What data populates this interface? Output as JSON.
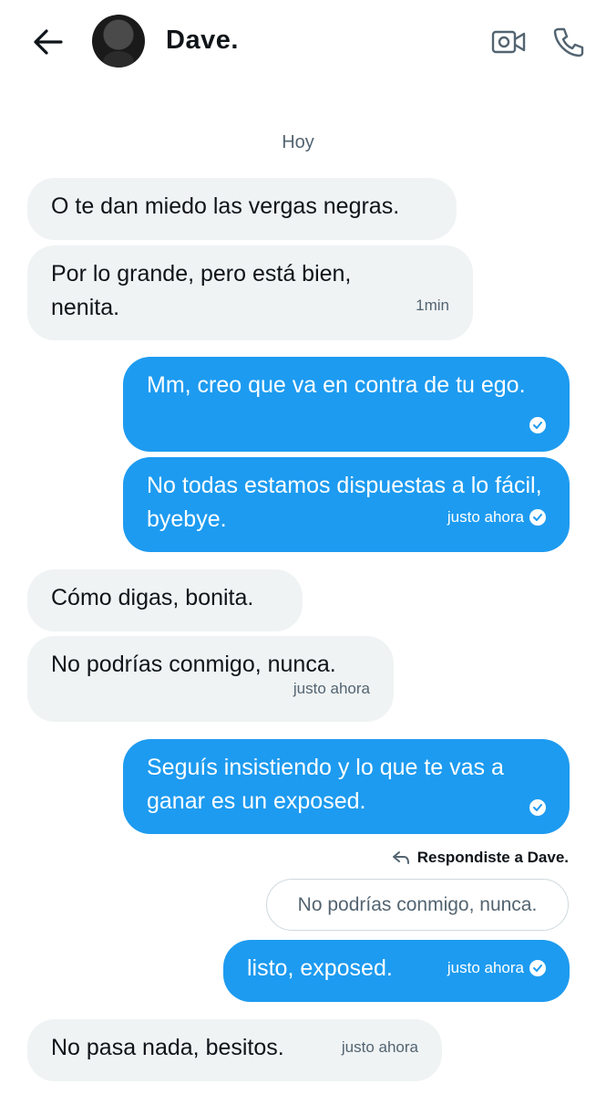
{
  "header": {
    "contact_name": "Dave.",
    "back_icon": "arrow-left-icon",
    "video_icon": "video-call-icon",
    "phone_icon": "phone-icon"
  },
  "divider": {
    "day_label": "Hoy"
  },
  "messages": [
    {
      "direction": "incoming",
      "text": "O te dan miedo las vergas negras.",
      "meta": ""
    },
    {
      "direction": "incoming",
      "text": "Por lo grande, pero está bien, nenita.",
      "meta": "1min"
    },
    {
      "direction": "outgoing",
      "text": "Mm, creo que va en contra de tu ego.",
      "meta": ""
    },
    {
      "direction": "outgoing",
      "text": "No todas estamos dispuestas a lo fácil, byebye.",
      "meta": "justo ahora"
    },
    {
      "direction": "incoming",
      "text": "Cómo digas, bonita.",
      "meta": ""
    },
    {
      "direction": "incoming",
      "text": "No podrías conmigo, nunca.",
      "meta": "justo ahora"
    },
    {
      "direction": "outgoing",
      "text": "Seguís insistiendo y lo que te vas a ganar es un exposed.",
      "meta": ""
    },
    {
      "direction": "outgoing",
      "text": "listo, exposed.",
      "meta": "justo ahora"
    },
    {
      "direction": "incoming",
      "text": "No pasa nada, besitos.",
      "meta": "justo ahora"
    }
  ],
  "reply": {
    "note": "Respondiste a Dave.",
    "quoted_text": "No podrías conmigo, nunca."
  },
  "colors": {
    "outgoing_bubble": "#1d9bf0",
    "incoming_bubble": "#eff3f4",
    "secondary_text": "#536471"
  }
}
